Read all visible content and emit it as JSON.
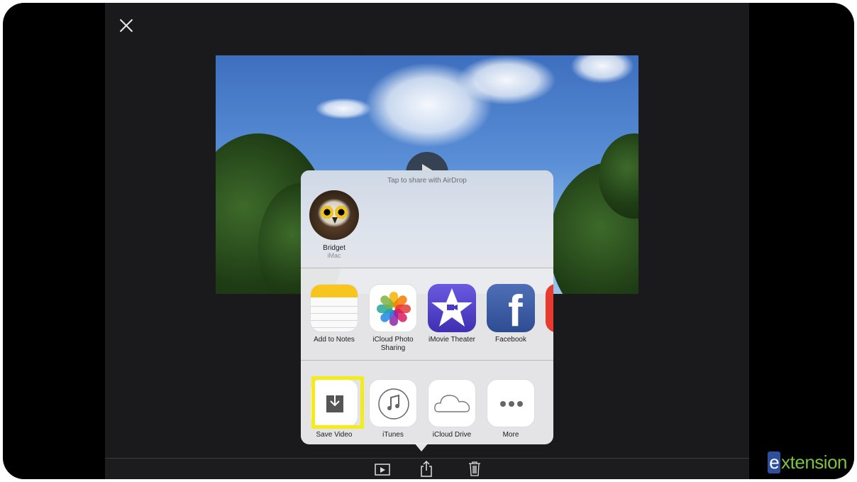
{
  "airdrop": {
    "hint": "Tap to share with AirDrop",
    "contact": {
      "name": "Bridget",
      "device": "iMac"
    }
  },
  "share_apps": [
    {
      "label": "Add to Notes",
      "icon": "notes-icon"
    },
    {
      "label": "iCloud Photo Sharing",
      "icon": "photos-icon"
    },
    {
      "label": "iMovie Theater",
      "icon": "imovie-icon"
    },
    {
      "label": "Facebook",
      "icon": "facebook-icon"
    }
  ],
  "actions": [
    {
      "label": "Save Video",
      "icon": "save-video-icon",
      "highlighted": true
    },
    {
      "label": "iTunes",
      "icon": "itunes-icon"
    },
    {
      "label": "iCloud Drive",
      "icon": "icloud-drive-icon"
    },
    {
      "label": "More",
      "icon": "more-icon"
    }
  ],
  "toolbar": {
    "icons": [
      "play-icon",
      "share-icon",
      "trash-icon"
    ]
  },
  "logo": {
    "mark": "e",
    "rest": "xtension"
  },
  "colors": {
    "highlight": "#f3ec18",
    "logo_green": "#7cc143",
    "logo_blue": "#2d4f9c"
  }
}
